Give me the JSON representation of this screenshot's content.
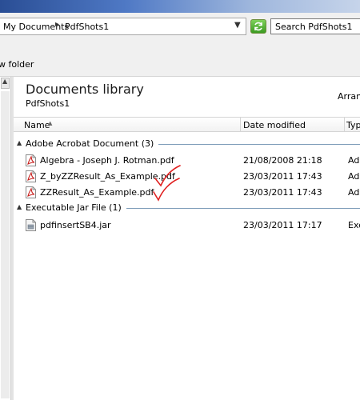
{
  "address": {
    "crumb1": "My Documents",
    "crumb2": "PdfShots1"
  },
  "search": {
    "placeholder": "Search PdfShots1"
  },
  "toolbar": {
    "new_folder_label": "w folder"
  },
  "library": {
    "title": "Documents library",
    "subtitle": "PdfShots1",
    "arrange_label": "Arrang"
  },
  "columns": {
    "name": "Name",
    "date_modified": "Date modified",
    "type": "Typ"
  },
  "groups": [
    {
      "label": "Adobe Acrobat Document (3)",
      "files": [
        {
          "name": "Algebra - Joseph J. Rotman.pdf",
          "date": "21/08/2008 21:18",
          "type": "Ado",
          "icon": "pdf-icon",
          "checked": false
        },
        {
          "name": "Z_byZZResult_As_Example.pdf",
          "date": "23/03/2011 17:43",
          "type": "Ado",
          "icon": "pdf-icon",
          "checked": true
        },
        {
          "name": "ZZResult_As_Example.pdf",
          "date": "23/03/2011 17:43",
          "type": "Ado",
          "icon": "pdf-icon",
          "checked": true
        }
      ]
    },
    {
      "label": "Executable Jar File (1)",
      "files": [
        {
          "name": "pdfinsertSB4.jar",
          "date": "23/03/2011 17:17",
          "type": "Exe",
          "icon": "jar-icon",
          "checked": false
        }
      ]
    }
  ],
  "colors": {
    "checkmark": "#e02020",
    "pdf_icon": "#c8201e"
  }
}
